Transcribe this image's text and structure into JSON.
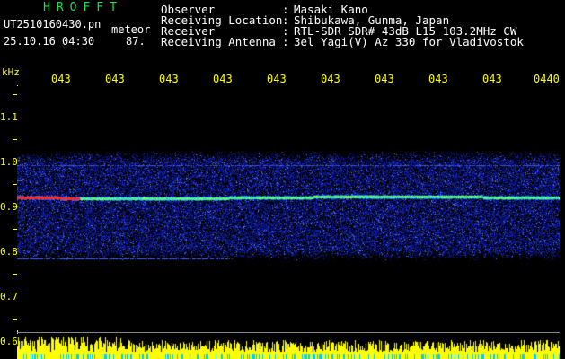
{
  "app": {
    "title": "HROFFT",
    "filename": "UT2510160430.pn",
    "meteor_label": "meteor",
    "datetime": "25.10.16 04:30",
    "count": "87."
  },
  "info": [
    {
      "key": "Observer",
      "value": "Masaki Kano"
    },
    {
      "key": "Receiving Location",
      "value": "Shibukawa, Gunma, Japan"
    },
    {
      "key": "Receiver",
      "value": "RTL-SDR SDR# 43dB L15 103.2MHz CW"
    },
    {
      "key": "Receiving Antenna",
      "value": "3el Yagi(V) Az 330 for Vladivostok"
    }
  ],
  "axis": {
    "unit": "kHz",
    "time_ticks": [
      "043",
      "043",
      "043",
      "043",
      "043",
      "043",
      "043",
      "043",
      "043",
      "0440"
    ],
    "freq_ticks": [
      "1.1",
      "1.0",
      "0.9",
      "0.8",
      "0.7",
      "0.6"
    ]
  },
  "colors": {
    "label": "#ffff00",
    "text": "#ffffff",
    "title": "#22dd44",
    "background": "#000000"
  }
}
